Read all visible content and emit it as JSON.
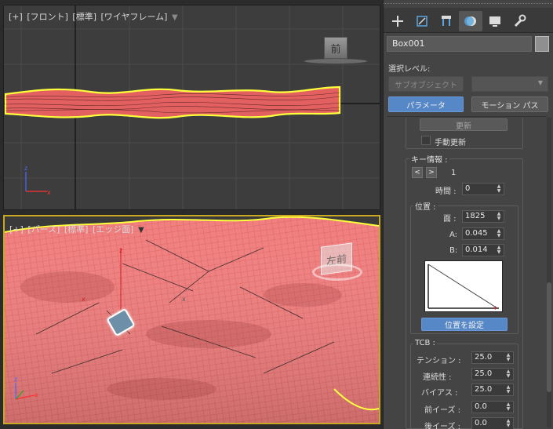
{
  "front_viewport": {
    "label_plus": "[+]",
    "label_view": "[フロント]",
    "label_shading": "[標準]",
    "label_mode": "[ワイヤフレーム]",
    "viewcube_label": "前"
  },
  "persp_viewport": {
    "label_plus": "[+]",
    "label_view": "[パース]",
    "label_shading": "[標準]",
    "label_mode": "[エッジ面]",
    "viewcube_label": "左前"
  },
  "command_panel": {
    "tabs": [
      "create-icon",
      "modify-icon",
      "hierarchy-icon",
      "motion-icon",
      "display-icon",
      "utilities-icon"
    ],
    "active_tab": "motion",
    "object_name": "Box001",
    "object_color": "#8f8f8f",
    "selection_level_label": "選択レベル:",
    "subobject_button": "サブオブジェクト",
    "parameters_button": "パラメータ",
    "motion_paths_button": "モーション パス",
    "update_button": "更新",
    "manual_update_label": "手動更新",
    "key_info": {
      "title": "キー情報 :",
      "prev": "<",
      "next": ">",
      "key_number": "1",
      "time_label": "時間 :",
      "time_value": "0"
    },
    "position": {
      "title": "位置 :",
      "face_label": "面 :",
      "face_value": "1825",
      "a_label": "A:",
      "a_value": "0.045",
      "b_label": "B:",
      "b_value": "0.014",
      "set_position_button": "位置を設定"
    },
    "tcb": {
      "title": "TCB :",
      "tension_label": "テンション :",
      "tension_value": "25.0",
      "continuity_label": "連続性 :",
      "continuity_value": "25.0",
      "bias_label": "バイアス :",
      "bias_value": "25.0",
      "ease_in_label": "前イーズ :",
      "ease_in_value": "0.0",
      "ease_out_label": "後イーズ :",
      "ease_out_value": "0.0"
    }
  },
  "colors": {
    "accent_blue": "#5687c7",
    "selection_yellow": "#ffff3c",
    "surface_red": "#e86a6a"
  }
}
